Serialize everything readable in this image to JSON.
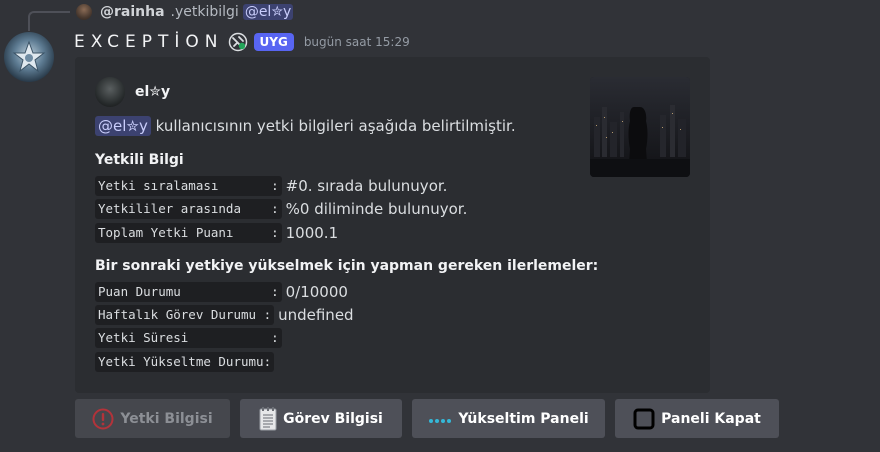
{
  "reply": {
    "username": "@rainha",
    "text": ".yetkibilgi",
    "mention": "@el✮y"
  },
  "message": {
    "username": "EXCEPTİON",
    "tag": "UYG",
    "timestamp": "bugün saat 15:29"
  },
  "embed": {
    "author": "el✮y",
    "description_mention": "@el✮y",
    "description_text": " kullanıcısının yetki bilgileri aşağıda belirtilmiştir.",
    "section1_title": "Yetkili Bilgi",
    "section1_rows": [
      {
        "label": "Yetki sıralaması       :",
        "value": "#0. sırada bulunuyor."
      },
      {
        "label": "Yetkililer arasında    :",
        "value": "%0 diliminde bulunuyor."
      },
      {
        "label": "Toplam Yetki Puanı     :",
        "value": "1000.1"
      }
    ],
    "section2_title": "Bir sonraki yetkiye yükselmek için yapman gereken ilerlemeler:",
    "section2_rows": [
      {
        "label": "Puan Durumu            :",
        "value": "0/10000"
      },
      {
        "label": "Haftalık Görev Durumu :",
        "value": "undefined"
      },
      {
        "label": "Yetki Süresi           :",
        "value": ""
      },
      {
        "label": "Yetki Yükseltme Durumu:",
        "value": ""
      }
    ]
  },
  "buttons": [
    {
      "label": "Yetki Bilgisi",
      "icon": "exclamation-icon",
      "disabled": true
    },
    {
      "label": "Görev Bilgisi",
      "icon": "notepad-icon",
      "disabled": false
    },
    {
      "label": "Yükseltim Paneli",
      "icon": "dots-icon",
      "disabled": false
    },
    {
      "label": "Paneli Kapat",
      "icon": "square-icon",
      "disabled": false
    }
  ],
  "colors": {
    "background": "#313338",
    "embed_bg": "#2b2d31",
    "mention_bg": "#3c4270",
    "tag_bg": "#5865f2",
    "button_bg": "#4e5058"
  }
}
